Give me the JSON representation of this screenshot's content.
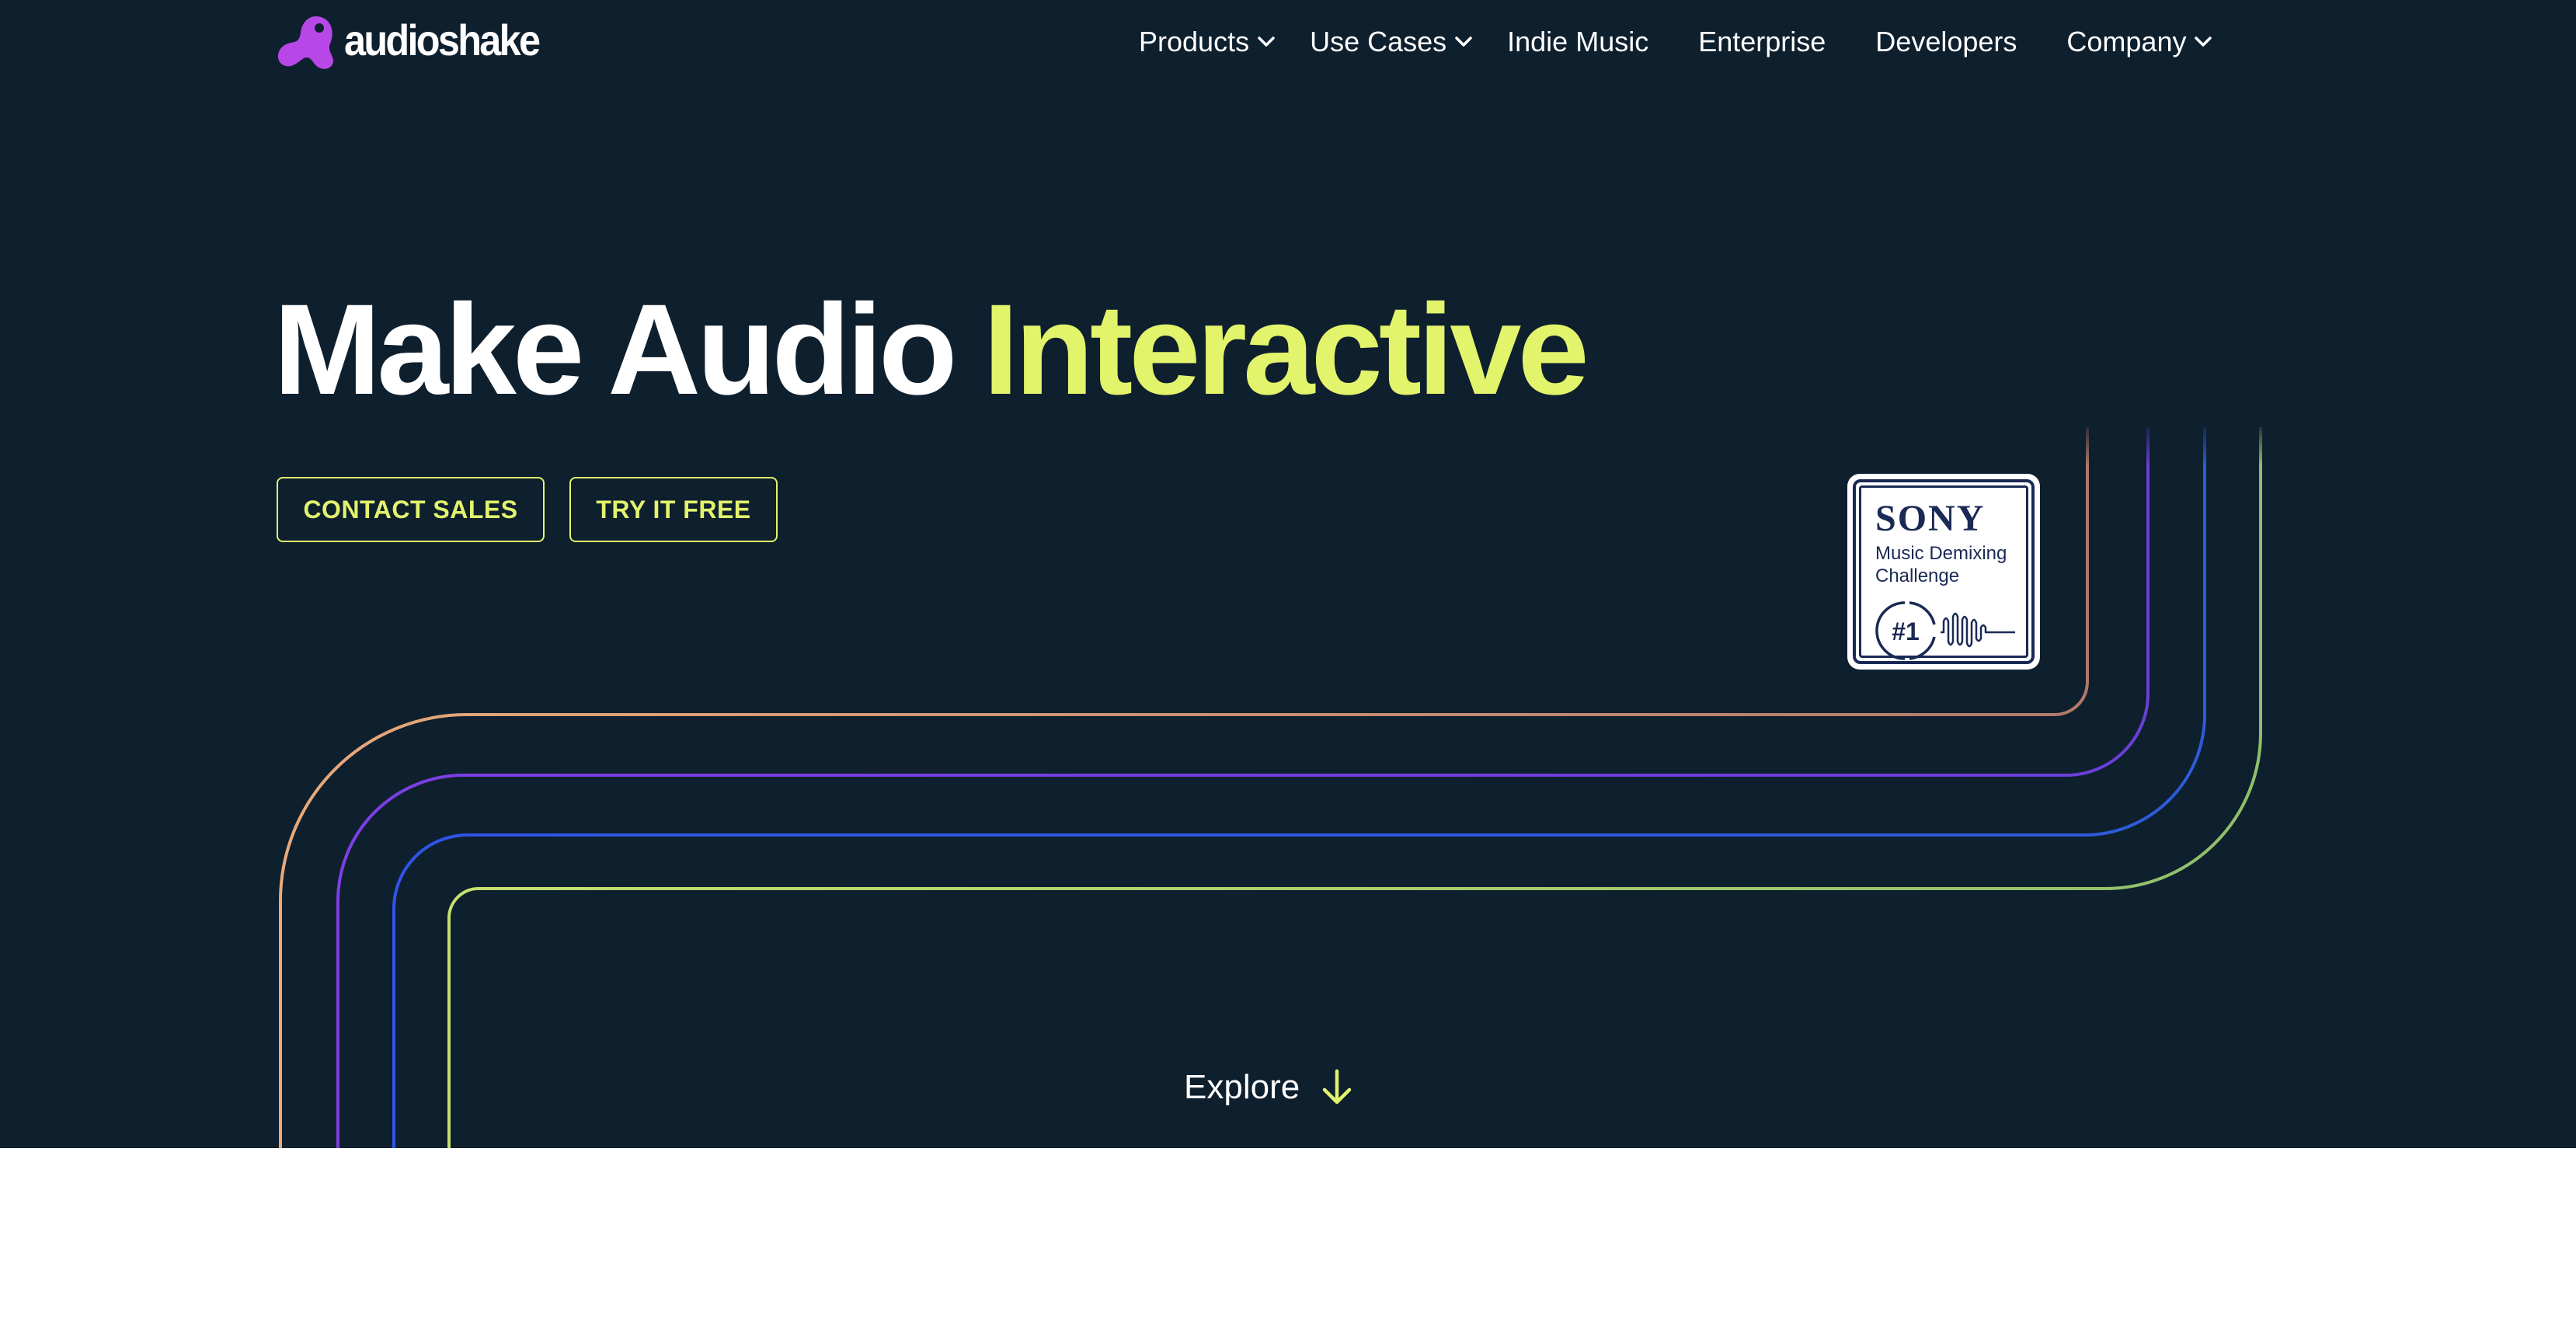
{
  "brand": {
    "name": "audioshake",
    "logo_icon": "audioshake-logo-icon"
  },
  "nav": {
    "items": [
      {
        "label": "Products",
        "dropdown": true
      },
      {
        "label": "Use Cases",
        "dropdown": true
      },
      {
        "label": "Indie Music",
        "dropdown": false
      },
      {
        "label": "Enterprise",
        "dropdown": false
      },
      {
        "label": "Developers",
        "dropdown": false
      },
      {
        "label": "Company",
        "dropdown": true
      }
    ]
  },
  "hero": {
    "headline_main": "Make Audio",
    "headline_accent": "Interactive",
    "buttons": {
      "contact": "CONTACT SALES",
      "try": "TRY IT FREE"
    },
    "badge": {
      "brand": "SONY",
      "line1": "Music Demixing",
      "line2": "Challenge",
      "rank": "#1"
    },
    "explore_label": "Explore"
  },
  "colors": {
    "hero_background": "#0e1f2e",
    "accent": "#e2f36c",
    "line_orange": "#d4936e",
    "line_purple": "#7b3fe0",
    "line_blue": "#2f56e0",
    "line_green": "#a3c76a",
    "page_background": "#ffffff"
  }
}
